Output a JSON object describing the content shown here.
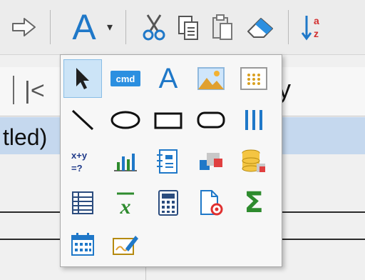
{
  "popup": {
    "tools": [
      {
        "id": "pointer",
        "label": ""
      },
      {
        "id": "command-button",
        "label": "cmd"
      },
      {
        "id": "text-label",
        "label": "A"
      },
      {
        "id": "image",
        "label": ""
      },
      {
        "id": "grid-dots",
        "label": ""
      },
      {
        "id": "line",
        "label": ""
      },
      {
        "id": "ellipse",
        "label": ""
      },
      {
        "id": "rectangle",
        "label": ""
      },
      {
        "id": "rounded-rectangle",
        "label": ""
      },
      {
        "id": "vertical-lines",
        "label": ""
      },
      {
        "id": "formula",
        "label": "x+y =?"
      },
      {
        "id": "chart",
        "label": ""
      },
      {
        "id": "rich-text",
        "label": ""
      },
      {
        "id": "subreport",
        "label": ""
      },
      {
        "id": "database",
        "label": ""
      },
      {
        "id": "cross-table",
        "label": ""
      },
      {
        "id": "average",
        "label": ""
      },
      {
        "id": "calculator",
        "label": ""
      },
      {
        "id": "page-settings",
        "label": ""
      },
      {
        "id": "sum",
        "label": "Σ"
      },
      {
        "id": "date",
        "label": ""
      },
      {
        "id": "signature",
        "label": ""
      }
    ],
    "selected": "pointer"
  },
  "toolbar": {
    "font_glyph": "A",
    "dropdown_glyph": "▾"
  },
  "nav": {
    "first_glyph": "|<",
    "field_fragment": "y"
  },
  "tree": {
    "selected_text": "tled)"
  },
  "colors": {
    "accent_blue": "#1f78c8",
    "selection_bg": "#c5d8ee",
    "green": "#2e8b2e"
  }
}
